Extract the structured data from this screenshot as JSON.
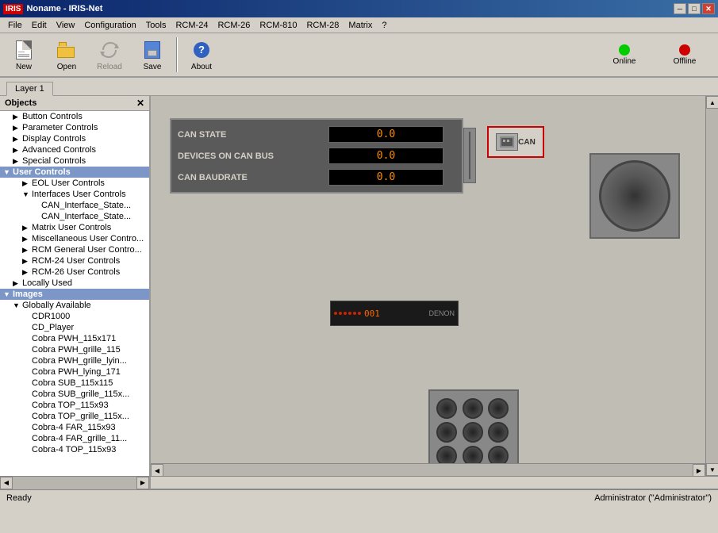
{
  "titleBar": {
    "appIcon": "iris-icon",
    "title": "Noname - IRIS-Net",
    "controls": [
      "minimize",
      "maximize",
      "close"
    ]
  },
  "menuBar": {
    "items": [
      "File",
      "Edit",
      "View",
      "Configuration",
      "Tools",
      "RCM-24",
      "RCM-26",
      "RCM-810",
      "RCM-28",
      "Matrix",
      "?"
    ]
  },
  "toolbar": {
    "buttons": [
      {
        "id": "new",
        "label": "New"
      },
      {
        "id": "open",
        "label": "Open"
      },
      {
        "id": "reload",
        "label": "Reload"
      },
      {
        "id": "save",
        "label": "Save"
      },
      {
        "id": "about",
        "label": "About"
      }
    ],
    "onlineLabel": "Online",
    "offlineLabel": "Offline"
  },
  "tab": {
    "label": "Layer 1"
  },
  "leftPanel": {
    "header": "Objects",
    "tree": [
      {
        "id": "button-controls",
        "label": "Button Controls",
        "indent": 1,
        "hasArrow": true,
        "expanded": false
      },
      {
        "id": "parameter-controls",
        "label": "Parameter Controls",
        "indent": 1,
        "hasArrow": true,
        "expanded": false
      },
      {
        "id": "display-controls",
        "label": "Display Controls",
        "indent": 1,
        "hasArrow": true,
        "expanded": false
      },
      {
        "id": "advanced-controls",
        "label": "Advanced Controls",
        "indent": 1,
        "hasArrow": true,
        "expanded": false
      },
      {
        "id": "special-controls",
        "label": "Special Controls",
        "indent": 1,
        "hasArrow": true,
        "expanded": false
      },
      {
        "id": "user-controls",
        "label": "User Controls",
        "indent": 0,
        "hasArrow": true,
        "expanded": true,
        "selected": true
      },
      {
        "id": "eol-user-controls",
        "label": "EOL User Controls",
        "indent": 2,
        "hasArrow": true,
        "expanded": false
      },
      {
        "id": "interfaces-user-controls",
        "label": "Interfaces User Controls",
        "indent": 2,
        "hasArrow": true,
        "expanded": true
      },
      {
        "id": "can-interface-state-1",
        "label": "CAN_Interface_State...",
        "indent": 3,
        "hasArrow": false
      },
      {
        "id": "can-interface-state-2",
        "label": "CAN_Interface_State...",
        "indent": 3,
        "hasArrow": false
      },
      {
        "id": "matrix-user-controls",
        "label": "Matrix User Controls",
        "indent": 2,
        "hasArrow": true,
        "expanded": false
      },
      {
        "id": "misc-user-controls",
        "label": "Miscellaneous User Contro...",
        "indent": 2,
        "hasArrow": true,
        "expanded": false
      },
      {
        "id": "rcm-general-controls",
        "label": "RCM General User Contro...",
        "indent": 2,
        "hasArrow": true,
        "expanded": false
      },
      {
        "id": "rcm24-user-controls",
        "label": "RCM-24 User Controls",
        "indent": 2,
        "hasArrow": true,
        "expanded": false
      },
      {
        "id": "rcm26-user-controls",
        "label": "RCM-26 User Controls",
        "indent": 2,
        "hasArrow": true,
        "expanded": false
      },
      {
        "id": "locally-used",
        "label": "Locally Used",
        "indent": 1,
        "hasArrow": true,
        "expanded": false
      },
      {
        "id": "images",
        "label": "Images",
        "indent": 0,
        "hasArrow": true,
        "expanded": true
      },
      {
        "id": "globally-available",
        "label": "Globally Available",
        "indent": 1,
        "hasArrow": true,
        "expanded": true
      },
      {
        "id": "cdr1000",
        "label": "CDR1000",
        "indent": 2,
        "hasArrow": false
      },
      {
        "id": "cd-player",
        "label": "CD_Player",
        "indent": 2,
        "hasArrow": false
      },
      {
        "id": "cobra-pwh-115x171",
        "label": "Cobra PWH_115x171",
        "indent": 2,
        "hasArrow": false
      },
      {
        "id": "cobra-pwh-grille-115",
        "label": "Cobra PWH_grille_115",
        "indent": 2,
        "hasArrow": false
      },
      {
        "id": "cobra-pwh-grille-lying",
        "label": "Cobra PWH_grille_lyin...",
        "indent": 2,
        "hasArrow": false
      },
      {
        "id": "cobra-pwh-lying-171",
        "label": "Cobra PWH_lying_171",
        "indent": 2,
        "hasArrow": false
      },
      {
        "id": "cobra-sub-115x115",
        "label": "Cobra SUB_115x115",
        "indent": 2,
        "hasArrow": false
      },
      {
        "id": "cobra-sub-grille-115",
        "label": "Cobra SUB_grille_115x...",
        "indent": 2,
        "hasArrow": false
      },
      {
        "id": "cobra-top-115x93",
        "label": "Cobra TOP_115x93",
        "indent": 2,
        "hasArrow": false
      },
      {
        "id": "cobra-top-grille-115",
        "label": "Cobra TOP_grille_115x...",
        "indent": 2,
        "hasArrow": false
      },
      {
        "id": "cobra-4-far-115x93",
        "label": "Cobra-4 FAR_115x93",
        "indent": 2,
        "hasArrow": false
      },
      {
        "id": "cobra-4-far-grille-11",
        "label": "Cobra-4 FAR_grille_11...",
        "indent": 2,
        "hasArrow": false
      },
      {
        "id": "cobra-4-top-115x93",
        "label": "Cobra-4 TOP_115x93",
        "indent": 2,
        "hasArrow": false
      }
    ]
  },
  "canPanel": {
    "rows": [
      {
        "label": "CAN STATE",
        "value": "0.0"
      },
      {
        "label": "DEVICES ON CAN BUS",
        "value": "0.0"
      },
      {
        "label": "CAN BAUDRATE",
        "value": "0.0"
      }
    ]
  },
  "statusBar": {
    "leftText": "Ready",
    "rightText": "Administrator (\"Administrator\")"
  }
}
